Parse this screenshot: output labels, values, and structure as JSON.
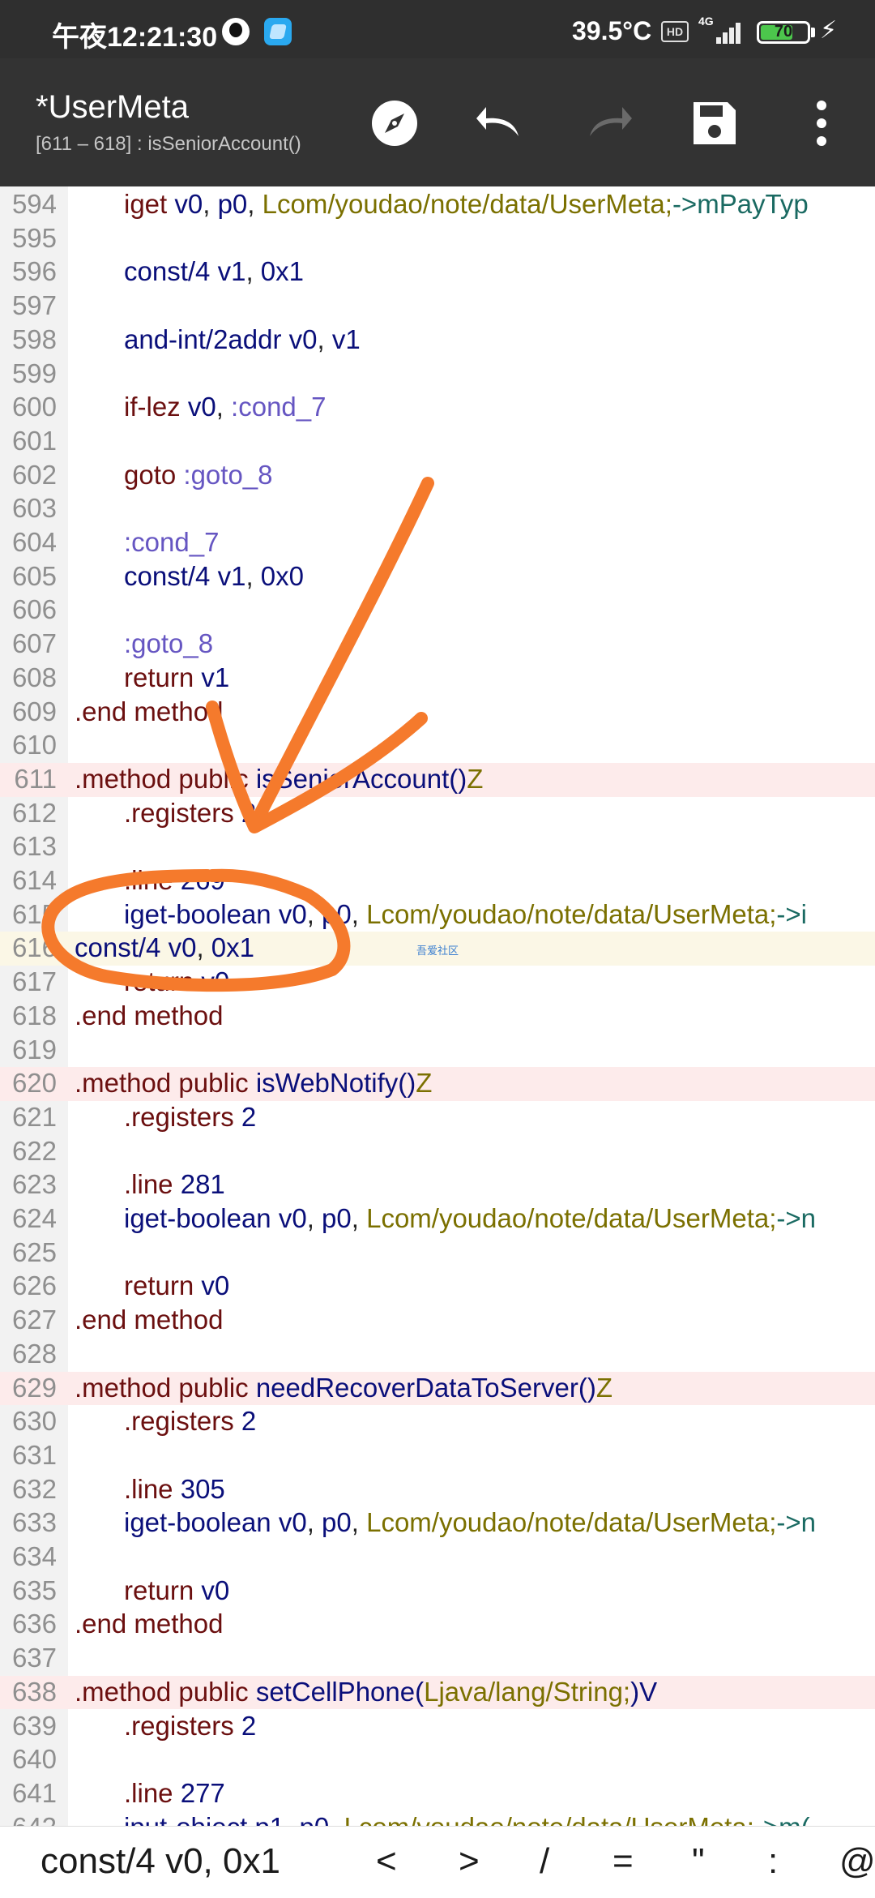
{
  "status_bar": {
    "time": "午夜12:21:30",
    "temperature": "39.5°C",
    "hd": "HD",
    "network": "4G",
    "battery": "70",
    "battery_level": 0.7
  },
  "toolbar": {
    "title": "*UserMeta",
    "subtitle": "[611 – 618] : isSeniorAccount()",
    "icons": [
      "compass-icon",
      "undo-icon",
      "redo-icon",
      "save-icon",
      "more-icon"
    ]
  },
  "editor": {
    "lines": [
      {
        "n": "594",
        "indent": true,
        "hl": "",
        "parts": [
          [
            "iget ",
            "k"
          ],
          [
            "v0",
            "p"
          ],
          [
            ", ",
            "dflt"
          ],
          [
            "p0",
            "p"
          ],
          [
            ", ",
            "dflt"
          ],
          [
            "Lcom/youdao/note/data/UserMeta;",
            "cls"
          ],
          [
            "->mPayTyp",
            "arr"
          ]
        ]
      },
      {
        "n": "595",
        "indent": true,
        "hl": "",
        "parts": []
      },
      {
        "n": "596",
        "indent": true,
        "hl": "",
        "parts": [
          [
            "const/4 ",
            "n"
          ],
          [
            "v1",
            "p"
          ],
          [
            ", ",
            "dflt"
          ],
          [
            "0x1",
            "n"
          ]
        ]
      },
      {
        "n": "597",
        "indent": true,
        "hl": "",
        "parts": []
      },
      {
        "n": "598",
        "indent": true,
        "hl": "",
        "parts": [
          [
            "and-int/2addr ",
            "n"
          ],
          [
            "v0",
            "p"
          ],
          [
            ", ",
            "dflt"
          ],
          [
            "v1",
            "p"
          ]
        ]
      },
      {
        "n": "599",
        "indent": true,
        "hl": "",
        "parts": []
      },
      {
        "n": "600",
        "indent": true,
        "hl": "",
        "parts": [
          [
            "if-lez ",
            "k"
          ],
          [
            "v0",
            "p"
          ],
          [
            ", ",
            "dflt"
          ],
          [
            ":cond_7",
            "lbl"
          ]
        ]
      },
      {
        "n": "601",
        "indent": true,
        "hl": "",
        "parts": []
      },
      {
        "n": "602",
        "indent": true,
        "hl": "",
        "parts": [
          [
            "goto ",
            "k"
          ],
          [
            ":goto_8",
            "lbl"
          ]
        ]
      },
      {
        "n": "603",
        "indent": true,
        "hl": "",
        "parts": []
      },
      {
        "n": "604",
        "indent": true,
        "hl": "",
        "parts": [
          [
            ":cond_7",
            "lbl"
          ]
        ]
      },
      {
        "n": "605",
        "indent": true,
        "hl": "",
        "parts": [
          [
            "const/4 ",
            "n"
          ],
          [
            "v1",
            "p"
          ],
          [
            ", ",
            "dflt"
          ],
          [
            "0x0",
            "n"
          ]
        ]
      },
      {
        "n": "606",
        "indent": true,
        "hl": "",
        "parts": []
      },
      {
        "n": "607",
        "indent": true,
        "hl": "",
        "parts": [
          [
            ":goto_8",
            "lbl"
          ]
        ]
      },
      {
        "n": "608",
        "indent": true,
        "hl": "",
        "parts": [
          [
            "return ",
            "k"
          ],
          [
            "v1",
            "p"
          ]
        ]
      },
      {
        "n": "609",
        "indent": false,
        "hl": "",
        "parts": [
          [
            ".end method",
            "k"
          ]
        ]
      },
      {
        "n": "610",
        "indent": false,
        "hl": "",
        "parts": []
      },
      {
        "n": "611",
        "indent": false,
        "hl": "method",
        "parts": [
          [
            ".method ",
            "k"
          ],
          [
            "public ",
            "k"
          ],
          [
            "isSeniorAccount()",
            "n"
          ],
          [
            "Z",
            "cls"
          ]
        ]
      },
      {
        "n": "612",
        "indent": true,
        "hl": "",
        "parts": [
          [
            ".registers ",
            "k"
          ],
          [
            "2",
            "n"
          ]
        ]
      },
      {
        "n": "613",
        "indent": true,
        "hl": "",
        "parts": []
      },
      {
        "n": "614",
        "indent": true,
        "hl": "",
        "parts": [
          [
            ".line ",
            "k"
          ],
          [
            "269",
            "n"
          ]
        ]
      },
      {
        "n": "615",
        "indent": true,
        "hl": "",
        "parts": [
          [
            "iget-boolean ",
            "n"
          ],
          [
            "v0",
            "p"
          ],
          [
            ", ",
            "dflt"
          ],
          [
            "p0",
            "p"
          ],
          [
            ", ",
            "dflt"
          ],
          [
            "Lcom/youdao/note/data/UserMeta;",
            "cls"
          ],
          [
            "->i",
            "arr"
          ]
        ]
      },
      {
        "n": "616",
        "indent": false,
        "hl": "current",
        "parts": [
          [
            "const/4 ",
            "n"
          ],
          [
            "v0",
            "p"
          ],
          [
            ", ",
            "dflt"
          ],
          [
            "0x1",
            "n"
          ]
        ]
      },
      {
        "n": "617",
        "indent": true,
        "hl": "",
        "parts": [
          [
            "return ",
            "k"
          ],
          [
            "v0",
            "p"
          ]
        ]
      },
      {
        "n": "618",
        "indent": false,
        "hl": "",
        "parts": [
          [
            ".end method",
            "k"
          ]
        ]
      },
      {
        "n": "619",
        "indent": false,
        "hl": "",
        "parts": []
      },
      {
        "n": "620",
        "indent": false,
        "hl": "method",
        "parts": [
          [
            ".method ",
            "k"
          ],
          [
            "public ",
            "k"
          ],
          [
            "isWebNotify()",
            "n"
          ],
          [
            "Z",
            "cls"
          ]
        ]
      },
      {
        "n": "621",
        "indent": true,
        "hl": "",
        "parts": [
          [
            ".registers ",
            "k"
          ],
          [
            "2",
            "n"
          ]
        ]
      },
      {
        "n": "622",
        "indent": true,
        "hl": "",
        "parts": []
      },
      {
        "n": "623",
        "indent": true,
        "hl": "",
        "parts": [
          [
            ".line ",
            "k"
          ],
          [
            "281",
            "n"
          ]
        ]
      },
      {
        "n": "624",
        "indent": true,
        "hl": "",
        "parts": [
          [
            "iget-boolean ",
            "n"
          ],
          [
            "v0",
            "p"
          ],
          [
            ", ",
            "dflt"
          ],
          [
            "p0",
            "p"
          ],
          [
            ", ",
            "dflt"
          ],
          [
            "Lcom/youdao/note/data/UserMeta;",
            "cls"
          ],
          [
            "->n",
            "arr"
          ]
        ]
      },
      {
        "n": "625",
        "indent": true,
        "hl": "",
        "parts": []
      },
      {
        "n": "626",
        "indent": true,
        "hl": "",
        "parts": [
          [
            "return ",
            "k"
          ],
          [
            "v0",
            "p"
          ]
        ]
      },
      {
        "n": "627",
        "indent": false,
        "hl": "",
        "parts": [
          [
            ".end method",
            "k"
          ]
        ]
      },
      {
        "n": "628",
        "indent": false,
        "hl": "",
        "parts": []
      },
      {
        "n": "629",
        "indent": false,
        "hl": "method",
        "parts": [
          [
            ".method ",
            "k"
          ],
          [
            "public ",
            "k"
          ],
          [
            "needRecoverDataToServer()",
            "n"
          ],
          [
            "Z",
            "cls"
          ]
        ]
      },
      {
        "n": "630",
        "indent": true,
        "hl": "",
        "parts": [
          [
            ".registers ",
            "k"
          ],
          [
            "2",
            "n"
          ]
        ]
      },
      {
        "n": "631",
        "indent": true,
        "hl": "",
        "parts": []
      },
      {
        "n": "632",
        "indent": true,
        "hl": "",
        "parts": [
          [
            ".line ",
            "k"
          ],
          [
            "305",
            "n"
          ]
        ]
      },
      {
        "n": "633",
        "indent": true,
        "hl": "",
        "parts": [
          [
            "iget-boolean ",
            "n"
          ],
          [
            "v0",
            "p"
          ],
          [
            ", ",
            "dflt"
          ],
          [
            "p0",
            "p"
          ],
          [
            ", ",
            "dflt"
          ],
          [
            "Lcom/youdao/note/data/UserMeta;",
            "cls"
          ],
          [
            "->n",
            "arr"
          ]
        ]
      },
      {
        "n": "634",
        "indent": true,
        "hl": "",
        "parts": []
      },
      {
        "n": "635",
        "indent": true,
        "hl": "",
        "parts": [
          [
            "return ",
            "k"
          ],
          [
            "v0",
            "p"
          ]
        ]
      },
      {
        "n": "636",
        "indent": false,
        "hl": "",
        "parts": [
          [
            ".end method",
            "k"
          ]
        ]
      },
      {
        "n": "637",
        "indent": false,
        "hl": "",
        "parts": []
      },
      {
        "n": "638",
        "indent": false,
        "hl": "method",
        "parts": [
          [
            ".method ",
            "k"
          ],
          [
            "public ",
            "k"
          ],
          [
            "setCellPhone(",
            "n"
          ],
          [
            "Ljava/lang/String;",
            "cls"
          ],
          [
            ")V",
            "n"
          ]
        ]
      },
      {
        "n": "639",
        "indent": true,
        "hl": "",
        "parts": [
          [
            ".registers ",
            "k"
          ],
          [
            "2",
            "n"
          ]
        ]
      },
      {
        "n": "640",
        "indent": true,
        "hl": "",
        "parts": []
      },
      {
        "n": "641",
        "indent": true,
        "hl": "",
        "parts": [
          [
            ".line ",
            "k"
          ],
          [
            "277",
            "n"
          ]
        ]
      },
      {
        "n": "642",
        "indent": true,
        "hl": "",
        "parts": [
          [
            "iput-object ",
            "n"
          ],
          [
            "p1",
            "p"
          ],
          [
            ", ",
            "dflt"
          ],
          [
            "p0",
            "p"
          ],
          [
            ", ",
            "dflt"
          ],
          [
            "Lcom/youdao/note/data/UserMeta;",
            "cls"
          ],
          [
            "->m(",
            "arr"
          ]
        ]
      }
    ],
    "watermark": "吾爱社区"
  },
  "quickbar": {
    "items": [
      "const/4 v0, 0x1",
      "<",
      ">",
      "/",
      "=",
      "\"",
      ":",
      "@"
    ]
  }
}
